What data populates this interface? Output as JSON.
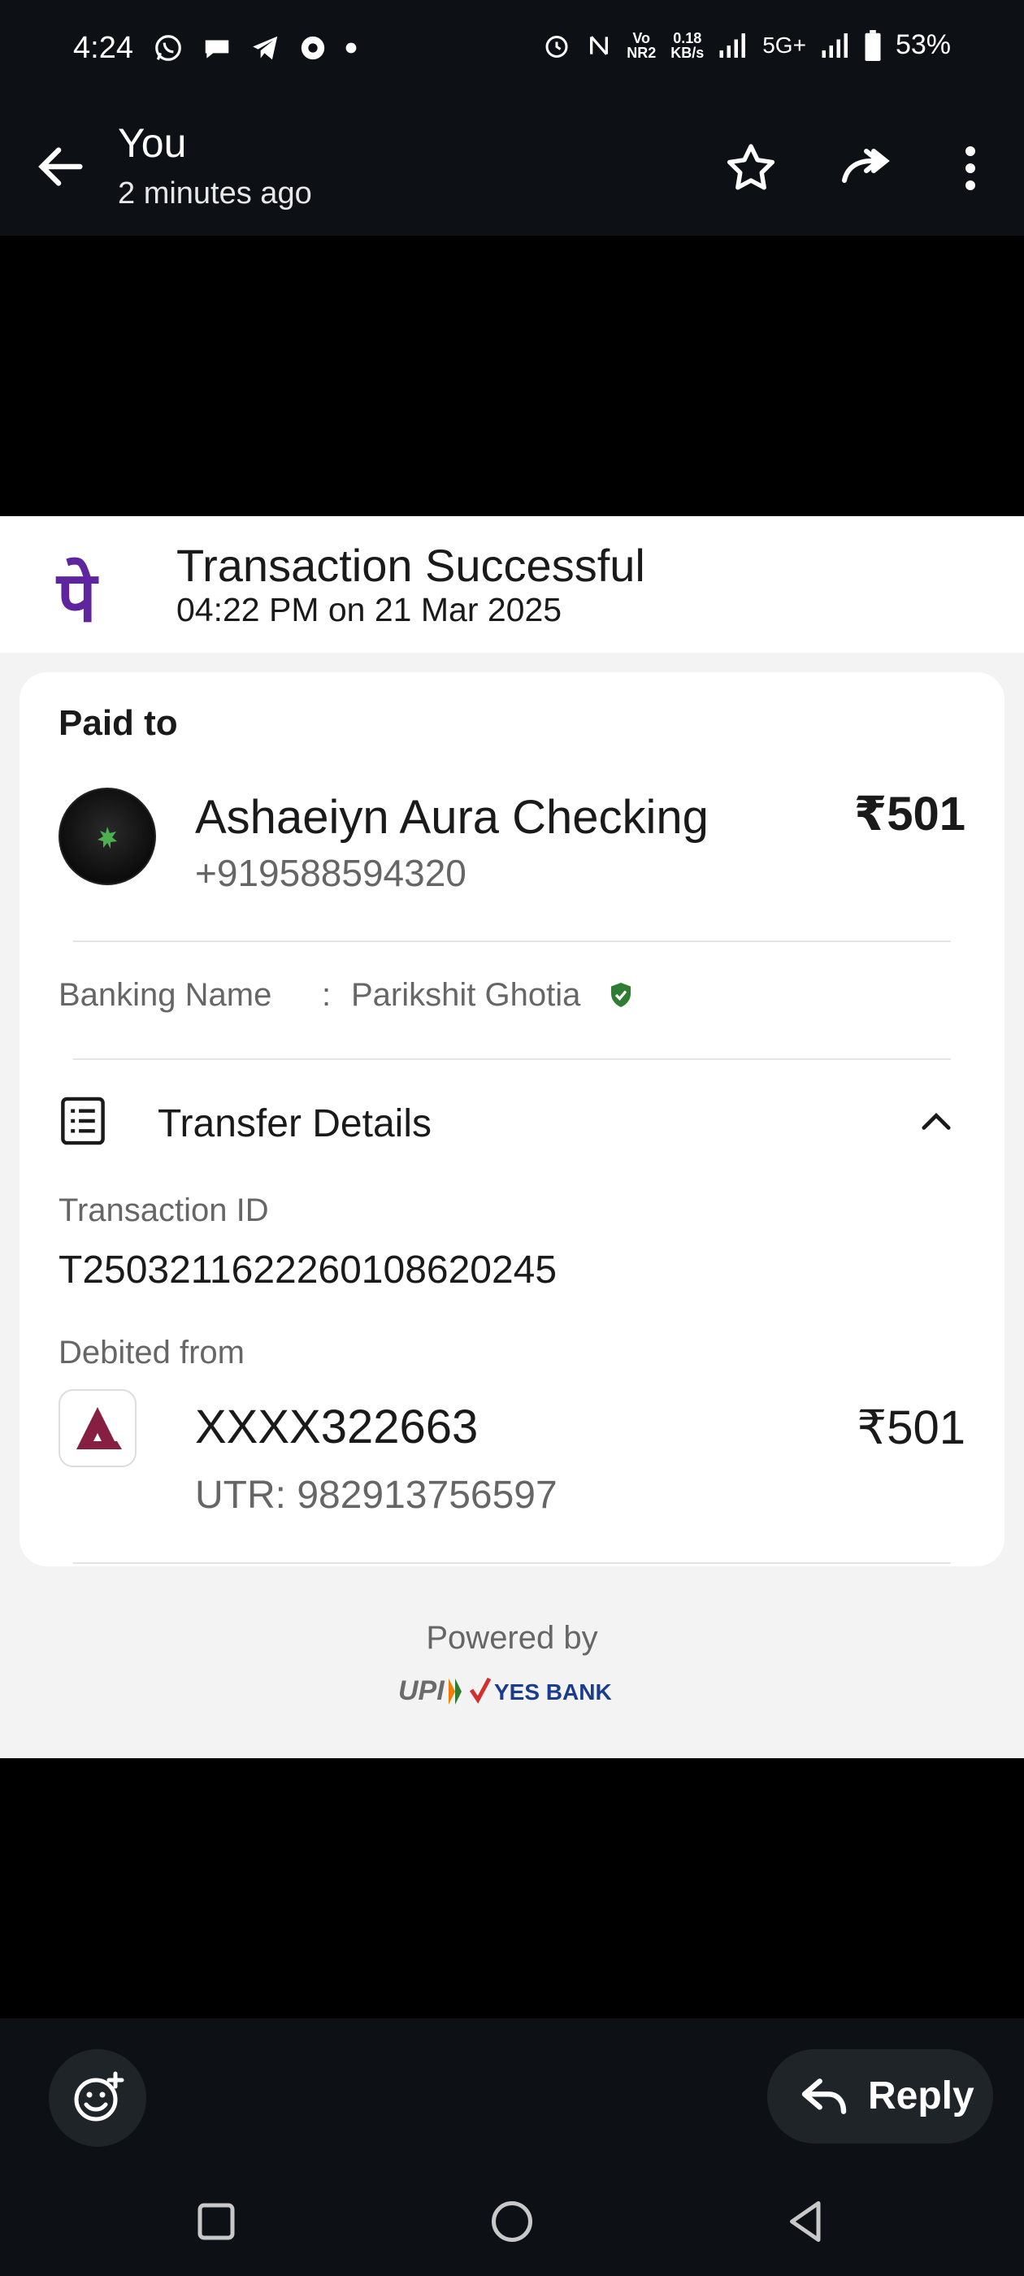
{
  "status_bar": {
    "time": "4:24",
    "net_speed_value": "0.18",
    "net_speed_unit": "KB/s",
    "volte_top": "Vo",
    "volte_bottom": "NR2",
    "network": "5G+",
    "battery": "53%"
  },
  "app_bar": {
    "title": "You",
    "subtitle": "2 minutes ago"
  },
  "receipt": {
    "logo_glyph": "पे",
    "status": "Transaction Successful",
    "datetime": "04:22 PM on 21 Mar 2025",
    "paid_to_label": "Paid to",
    "payee_name": "Ashaeiyn Aura Checking",
    "payee_phone": "+919588594320",
    "amount": "₹501",
    "banking_name_label": "Banking Name",
    "banking_colon": ":",
    "banking_name": "Parikshit Ghotia",
    "transfer_details_label": "Transfer Details",
    "transaction_id_label": "Transaction ID",
    "transaction_id": "T2503211622260108620245",
    "debited_from_label": "Debited from",
    "account": "XXXX322663",
    "debit_amount": "₹501",
    "utr": "UTR: 982913756597",
    "powered_by": "Powered by"
  },
  "bottom_bar": {
    "reply_label": "Reply"
  },
  "colors": {
    "brand_purple": "#5f259f",
    "verified_green": "#2e7d32",
    "axis_maroon": "#861f41",
    "bar_bg": "#0d1116"
  },
  "icons": [
    "back-arrow-icon",
    "star-icon",
    "forward-icon",
    "more-vert-icon",
    "verified-shield-icon",
    "receipt-list-icon",
    "chevron-up-icon",
    "emoji-add-icon",
    "reply-icon",
    "recents-icon",
    "home-icon",
    "back-triangle-icon"
  ]
}
